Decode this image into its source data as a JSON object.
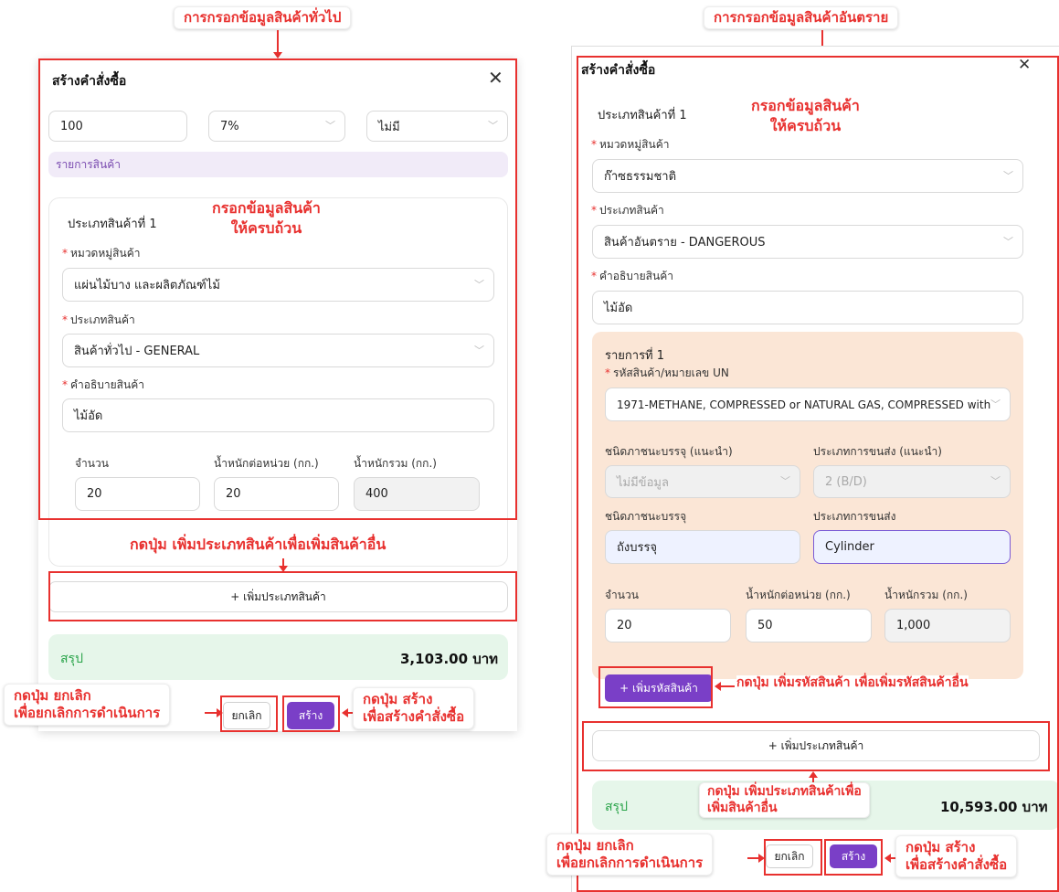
{
  "left": {
    "heading": "การกรอกข้อมูลสินค้าทั่วไป",
    "modal_title": "สร้างคำสั่งซื้อ",
    "top_fields": [
      "100",
      "7%",
      "ไม่มี"
    ],
    "list_band": "รายการสินค้า",
    "section_title": "ประเภทสินค้าที่ 1",
    "fill_note_1": "กรอกข้อมูลสินค้า",
    "fill_note_2": "ให้ครบถ้วน",
    "category_label": "หมวดหมู่สินค้า",
    "category_value": "แผ่นไม้บาง และผลิตภัณฑ์ไม้",
    "type_label": "ประเภทสินค้า",
    "type_value": "สินค้าทั่วไป - GENERAL",
    "desc_label": "คำอธิบายสินค้า",
    "desc_value": "ไม้อัด",
    "qty_label": "จำนวน",
    "unit_weight_label": "น้ำหนักต่อหน่วย (กก.)",
    "total_weight_label": "น้ำหนักรวม (กก.)",
    "qty_value": "20",
    "unit_weight_value": "20",
    "total_weight_value": "400",
    "add_type_note": "กดปุ่ม เพิ่มประเภทสินค้าเพื่อเพิ่มสินค้าอื่น",
    "add_type_button": "+ เพิ่มประเภทสินค้า",
    "summary_label": "สรุป",
    "summary_value": "3,103.00 บาท",
    "cancel_note_1": "กดปุ่ม ยกเลิก",
    "cancel_note_2": "เพื่อยกเลิกการดำเนินการ",
    "cancel_button": "ยกเลิก",
    "create_button": "สร้าง",
    "create_note_1": "กดปุ่ม สร้าง",
    "create_note_2": "เพื่อสร้างคำสั่งซื้อ"
  },
  "right": {
    "heading": "การกรอกข้อมูลสินค้าอันตราย",
    "modal_title": "สร้างคำสั่งซื้อ",
    "section_title": "ประเภทสินค้าที่ 1",
    "fill_note_1": "กรอกข้อมูลสินค้า",
    "fill_note_2": "ให้ครบถ้วน",
    "category_label": "หมวดหมู่สินค้า",
    "category_value": "ก๊าซธรรมชาติ",
    "type_label": "ประเภทสินค้า",
    "type_value": "สินค้าอันตราย - DANGEROUS",
    "desc_label": "คำอธิบายสินค้า",
    "desc_value": "ไม้อัด",
    "item_title": "รายการที่ 1",
    "un_label": "รหัสสินค้า/หมายเลข UN",
    "un_value": "1971-METHANE, COMPRESSED or NATURAL GAS, COMPRESSED with...",
    "pkg_suggest_label": "ชนิดภาชนะบรรจุ (แนะนำ)",
    "transport_suggest_label": "ประเภทการขนส่ง (แนะนำ)",
    "pkg_suggest_value": "ไม่มีข้อมูล",
    "transport_suggest_value": "2 (B/D)",
    "pkg_label": "ชนิดภาชนะบรรจุ",
    "transport_label": "ประเภทการขนส่ง",
    "pkg_value": "ถังบรรจุ",
    "transport_value": "Cylinder",
    "qty_label": "จำนวน",
    "unit_weight_label": "น้ำหนักต่อหน่วย (กก.)",
    "total_weight_label": "น้ำหนักรวม (กก.)",
    "qty_value": "20",
    "unit_weight_value": "50",
    "total_weight_value": "1,000",
    "add_code_button": "+ เพิ่มรหัสสินค้า",
    "add_code_note": "กดปุ่ม เพิ่มรหัสสินค้า เพื่อเพิ่มรหัสสินค้าอื่น",
    "add_type_button": "+ เพิ่มประเภทสินค้า",
    "add_type_note_1": "กดปุ่ม เพิ่มประเภทสินค้าเพื่อ",
    "add_type_note_2": "เพิ่มสินค้าอื่น",
    "summary_label": "สรุป",
    "summary_value": "10,593.00 บาท",
    "cancel_note_1": "กดปุ่ม ยกเลิก",
    "cancel_note_2": "เพื่อยกเลิกการดำเนินการ",
    "cancel_button": "ยกเลิก",
    "create_button": "สร้าง",
    "create_note_1": "กดปุ่ม สร้าง",
    "create_note_2": "เพื่อสร้างคำสั่งซื้อ"
  },
  "colors": {
    "annotation_red": "#e8312f",
    "primary_purple": "#7a3fc7",
    "summary_green": "#2aa44a",
    "peach": "#fbe6d6"
  },
  "icons": {
    "close": "close-icon",
    "dropdown": "chevron-down-icon",
    "plus": "plus-icon"
  }
}
